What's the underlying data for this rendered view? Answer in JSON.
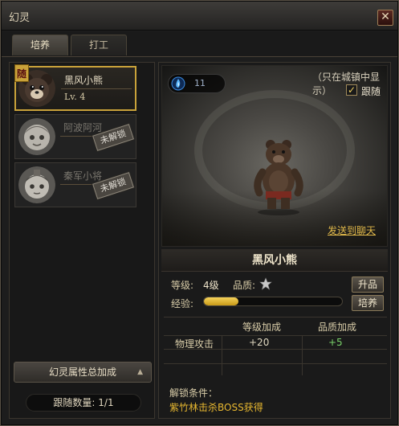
{
  "window": {
    "title": "幻灵",
    "close_symbol": "✕"
  },
  "tabs": [
    {
      "label": "培养",
      "active": true
    },
    {
      "label": "打工",
      "active": false
    }
  ],
  "characters": [
    {
      "name": "黑风小熊",
      "level": "Lv. 4",
      "badge": "随",
      "selected": true,
      "locked": false
    },
    {
      "name": "阿波阿河",
      "stamp": "未解锁",
      "selected": false,
      "locked": true
    },
    {
      "name": "秦军小将",
      "stamp": "未解锁",
      "selected": false,
      "locked": true
    }
  ],
  "left_panel": {
    "total_bonus_label": "幻灵属性总加成",
    "follow_count_label": "跟随数量",
    "follow_count_value": "1/1"
  },
  "scene": {
    "energy_value": "11",
    "city_only": "（只在城镇中显示）",
    "follow_label": "跟随",
    "follow_checked": true,
    "send_chat": "发送到聊天"
  },
  "pet": {
    "name": "黑风小熊",
    "level_label": "等级:",
    "level_value": "4级",
    "quality_label": "品质:",
    "upgrade_button": "升品",
    "exp_label": "经验:",
    "exp_fraction": 0.25,
    "train_button": "培养"
  },
  "bonus_table": {
    "headers": [
      "等级加成",
      "品质加成"
    ],
    "rows": [
      {
        "attr": "物理攻击",
        "level_bonus": "+20",
        "quality_bonus": "+5"
      }
    ]
  },
  "unlock": {
    "label": "解锁条件：",
    "text": "紫竹林击杀BOSS获得"
  },
  "colors": {
    "gold": "#c9a23a",
    "bonus_green": "#7ad36a",
    "unlock_text": "#e8b830"
  }
}
